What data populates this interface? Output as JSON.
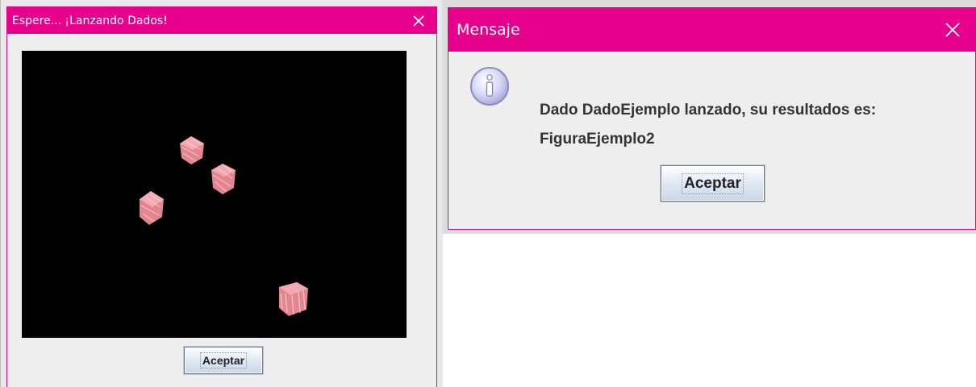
{
  "colors": {
    "titlebar": "#e6008c",
    "dialog_bg": "#eeeeee",
    "canvas_bg": "#000000",
    "die": "#e9939b"
  },
  "dice_dialog": {
    "title": "Espere... ¡Lanzando Dados!",
    "close_icon": "close-icon",
    "accept_label": "Aceptar",
    "dice_count": 4
  },
  "message_dialog": {
    "title": "Mensaje",
    "close_icon": "close-icon",
    "icon": "info-icon",
    "message_line_1": "Dado DadoEjemplo lanzado, su resultados es:",
    "message_line_2": "FiguraEjemplo2",
    "accept_label": "Aceptar"
  }
}
